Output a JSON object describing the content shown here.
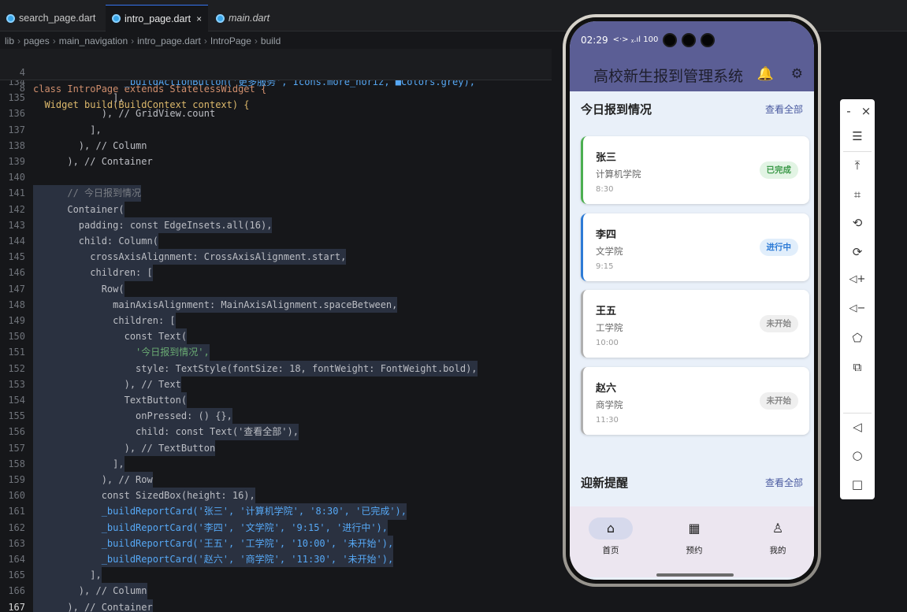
{
  "tabs": [
    {
      "label": "search_page.dart",
      "active": false
    },
    {
      "label": "intro_page.dart",
      "active": true,
      "close": "×"
    },
    {
      "label": "main.dart",
      "active": false
    }
  ],
  "breadcrumb": [
    "lib",
    "pages",
    "main_navigation",
    "intro_page.dart",
    "IntroPage",
    "build"
  ],
  "sticky": [
    {
      "ln": "4",
      "code": "class IntroPage extends StatelessWidget {"
    },
    {
      "ln": "8",
      "code": "  Widget build(BuildContext context) {"
    }
  ],
  "code_lines": [
    {
      "ln": "134",
      "code": "                _buildActionButton('更多服务', Icons.more_horiz, ■Colors.grey),"
    },
    {
      "ln": "135",
      "code": "              ],"
    },
    {
      "ln": "136",
      "code": "            ), // GridView.count"
    },
    {
      "ln": "137",
      "code": "          ],"
    },
    {
      "ln": "138",
      "code": "        ), // Column"
    },
    {
      "ln": "139",
      "code": "      ), // Container"
    },
    {
      "ln": "140",
      "code": ""
    },
    {
      "ln": "141",
      "code": "      // 今日报到情况"
    },
    {
      "ln": "142",
      "code": "      Container("
    },
    {
      "ln": "143",
      "code": "        padding: const EdgeInsets.all(16),"
    },
    {
      "ln": "144",
      "code": "        child: Column("
    },
    {
      "ln": "145",
      "code": "          crossAxisAlignment: CrossAxisAlignment.start,"
    },
    {
      "ln": "146",
      "code": "          children: ["
    },
    {
      "ln": "147",
      "code": "            Row("
    },
    {
      "ln": "148",
      "code": "              mainAxisAlignment: MainAxisAlignment.spaceBetween,"
    },
    {
      "ln": "149",
      "code": "              children: ["
    },
    {
      "ln": "150",
      "code": "                const Text("
    },
    {
      "ln": "151",
      "code": "                  '今日报到情况',"
    },
    {
      "ln": "152",
      "code": "                  style: TextStyle(fontSize: 18, fontWeight: FontWeight.bold),"
    },
    {
      "ln": "153",
      "code": "                ), // Text"
    },
    {
      "ln": "154",
      "code": "                TextButton("
    },
    {
      "ln": "155",
      "code": "                  onPressed: () {},"
    },
    {
      "ln": "156",
      "code": "                  child: const Text('查看全部'),"
    },
    {
      "ln": "157",
      "code": "                ), // TextButton"
    },
    {
      "ln": "158",
      "code": "              ],"
    },
    {
      "ln": "159",
      "code": "            ), // Row"
    },
    {
      "ln": "160",
      "code": "            const SizedBox(height: 16),"
    },
    {
      "ln": "161",
      "code": "            _buildReportCard('张三', '计算机学院', '8:30', '已完成'),"
    },
    {
      "ln": "162",
      "code": "            _buildReportCard('李四', '文学院', '9:15', '进行中'),"
    },
    {
      "ln": "163",
      "code": "            _buildReportCard('王五', '工学院', '10:00', '未开始'),"
    },
    {
      "ln": "164",
      "code": "            _buildReportCard('赵六', '商学院', '11:30', '未开始'),"
    },
    {
      "ln": "165",
      "code": "          ],"
    },
    {
      "ln": "166",
      "code": "        ), // Column"
    },
    {
      "ln": "167",
      "code": "      ), // Container"
    }
  ],
  "phone": {
    "status_time": "02:29",
    "status_icons": "<·> ᵪ.ıl 100",
    "app_title": "高校新生报到管理系统",
    "bell_icon": "🔔",
    "gear_icon": "⚙",
    "section1_title": "今日报到情况",
    "section1_link": "查看全部",
    "cards": [
      {
        "name": "张三",
        "college": "计算机学院",
        "time": "8:30",
        "status": "已完成",
        "badge_bg": "#e2f4e4",
        "badge_fg": "#3d9a4a",
        "bar": "#4caf50"
      },
      {
        "name": "李四",
        "college": "文学院",
        "time": "9:15",
        "status": "进行中",
        "badge_bg": "#e1eefb",
        "badge_fg": "#2d7bd6",
        "bar": "#2d7bd6"
      },
      {
        "name": "王五",
        "college": "工学院",
        "time": "10:00",
        "status": "未开始",
        "badge_bg": "#efefef",
        "badge_fg": "#888888",
        "bar": "#b0b0b0"
      },
      {
        "name": "赵六",
        "college": "商学院",
        "time": "11:30",
        "status": "未开始",
        "badge_bg": "#efefef",
        "badge_fg": "#888888",
        "bar": "#b0b0b0"
      }
    ],
    "section2_title": "迎新提醒",
    "section2_link": "查看全部",
    "nav": [
      {
        "label": "首页",
        "icon": "⌂"
      },
      {
        "label": "预约",
        "icon": "▦"
      },
      {
        "label": "我的",
        "icon": "♙"
      }
    ]
  },
  "emulator_toolbar": {
    "minimize": "-",
    "close": "×",
    "menu": "☰",
    "pin": "⤒",
    "crop": "⌗",
    "rotate_left": "⟲",
    "rotate_right": "⟳",
    "volume_up": "◁+",
    "volume_down": "◁−",
    "shake": "⬠",
    "snapshot": "⧉",
    "back": "◁",
    "home": "○",
    "overview": "□"
  }
}
